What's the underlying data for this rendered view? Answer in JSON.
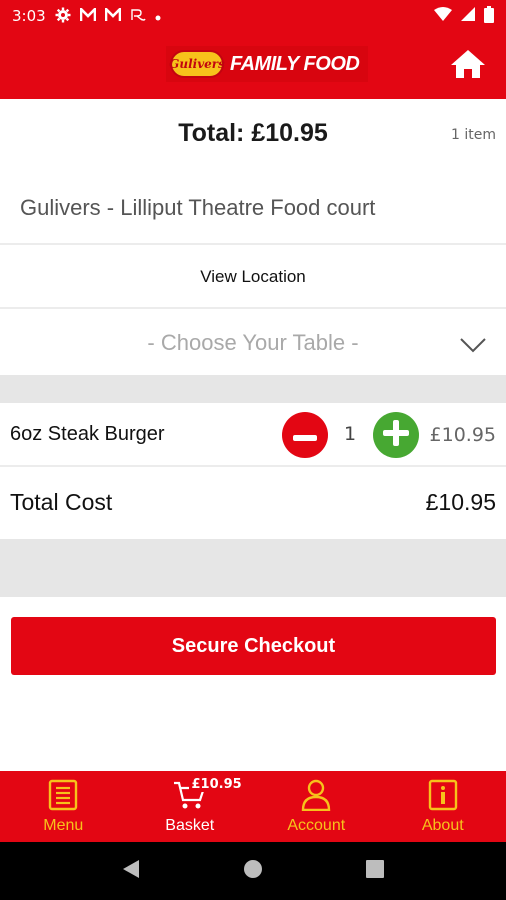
{
  "status_bar": {
    "time": "3:03",
    "icons_left": [
      "gear-icon",
      "gmail-icon",
      "gmail-icon",
      "app-r-icon",
      "dot-icon"
    ],
    "icons_right": [
      "wifi-icon",
      "signal-icon",
      "battery-icon"
    ]
  },
  "header": {
    "logo_badge": "Gulivers",
    "logo_text": "FAMILY FOOD",
    "home_icon": "home-icon"
  },
  "order": {
    "total_title": "Total: £10.95",
    "item_count": "1 item",
    "venue": "Gulivers - Lilliput Theatre Food court",
    "view_location": "View Location",
    "table_placeholder": "- Choose Your Table -"
  },
  "items": [
    {
      "name": "6oz Steak Burger",
      "quantity": "1",
      "price": "£10.95"
    }
  ],
  "totals": {
    "label": "Total Cost",
    "value": "£10.95"
  },
  "checkout": {
    "label": "Secure Checkout"
  },
  "bottom_nav": {
    "basket_price": "£10.95",
    "items": [
      {
        "label": "Menu",
        "icon": "menu-book-icon"
      },
      {
        "label": "Basket",
        "icon": "cart-icon"
      },
      {
        "label": "Account",
        "icon": "user-icon"
      },
      {
        "label": "About",
        "icon": "info-icon"
      }
    ]
  },
  "colors": {
    "brand_red": "#e30613",
    "accent_yellow": "#f7c21b",
    "plus_green": "#47a832",
    "band_gray": "#e6e6e6"
  }
}
